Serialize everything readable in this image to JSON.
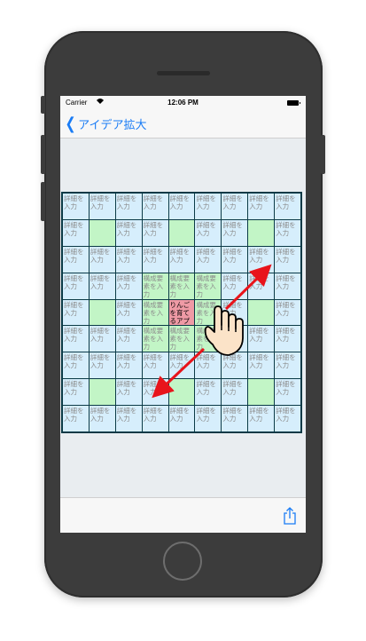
{
  "status": {
    "carrier": "Carrier",
    "time": "12:06 PM",
    "wifi_icon": "wifi-icon",
    "battery_icon": "battery-icon"
  },
  "nav": {
    "back_label": "アイデア拡大"
  },
  "toolbar": {
    "share_icon": "share-icon"
  },
  "grid": {
    "placeholder": "詳細を入力",
    "element_placeholder": "構成要素を入力",
    "center_text": "りんごを育てるアプリ",
    "rows": [
      [
        {
          "t": "p"
        },
        {
          "t": "p"
        },
        {
          "t": "p"
        },
        {
          "t": "p"
        },
        {
          "t": "p"
        },
        {
          "t": "p"
        },
        {
          "t": "p"
        },
        {
          "t": "p"
        },
        {
          "t": "p"
        }
      ],
      [
        {
          "t": "p"
        },
        {
          "t": "e"
        },
        {
          "t": "p"
        },
        {
          "t": "p"
        },
        {
          "t": "e"
        },
        {
          "t": "p"
        },
        {
          "t": "p"
        },
        {
          "t": "e"
        },
        {
          "t": "p"
        }
      ],
      [
        {
          "t": "p"
        },
        {
          "t": "p"
        },
        {
          "t": "p"
        },
        {
          "t": "p"
        },
        {
          "t": "p"
        },
        {
          "t": "p"
        },
        {
          "t": "p"
        },
        {
          "t": "p"
        },
        {
          "t": "p"
        }
      ],
      [
        {
          "t": "p"
        },
        {
          "t": "p"
        },
        {
          "t": "p"
        },
        {
          "t": "g"
        },
        {
          "t": "g"
        },
        {
          "t": "g"
        },
        {
          "t": "p"
        },
        {
          "t": "p"
        },
        {
          "t": "p"
        }
      ],
      [
        {
          "t": "p"
        },
        {
          "t": "e"
        },
        {
          "t": "p"
        },
        {
          "t": "g"
        },
        {
          "t": "c"
        },
        {
          "t": "g"
        },
        {
          "t": "p"
        },
        {
          "t": "e"
        },
        {
          "t": "p"
        }
      ],
      [
        {
          "t": "p"
        },
        {
          "t": "p"
        },
        {
          "t": "p"
        },
        {
          "t": "g"
        },
        {
          "t": "g"
        },
        {
          "t": "g"
        },
        {
          "t": "p"
        },
        {
          "t": "p"
        },
        {
          "t": "p"
        }
      ],
      [
        {
          "t": "p"
        },
        {
          "t": "p"
        },
        {
          "t": "p"
        },
        {
          "t": "p"
        },
        {
          "t": "p"
        },
        {
          "t": "p"
        },
        {
          "t": "p"
        },
        {
          "t": "p"
        },
        {
          "t": "p"
        }
      ],
      [
        {
          "t": "p"
        },
        {
          "t": "e"
        },
        {
          "t": "p"
        },
        {
          "t": "p"
        },
        {
          "t": "e"
        },
        {
          "t": "p"
        },
        {
          "t": "p"
        },
        {
          "t": "e"
        },
        {
          "t": "p"
        }
      ],
      [
        {
          "t": "p"
        },
        {
          "t": "p"
        },
        {
          "t": "p"
        },
        {
          "t": "p"
        },
        {
          "t": "p"
        },
        {
          "t": "p"
        },
        {
          "t": "p"
        },
        {
          "t": "p"
        },
        {
          "t": "p"
        }
      ]
    ]
  },
  "gesture": {
    "hand_icon": "pinch-hand-icon",
    "arrow_color": "#e8141b"
  },
  "colors": {
    "accent": "#1a7cf5",
    "cell": "#d6eefc",
    "element_cell": "#c2f5c6",
    "center_cell": "#ef9aa5",
    "grid_line": "#0b3a46"
  }
}
